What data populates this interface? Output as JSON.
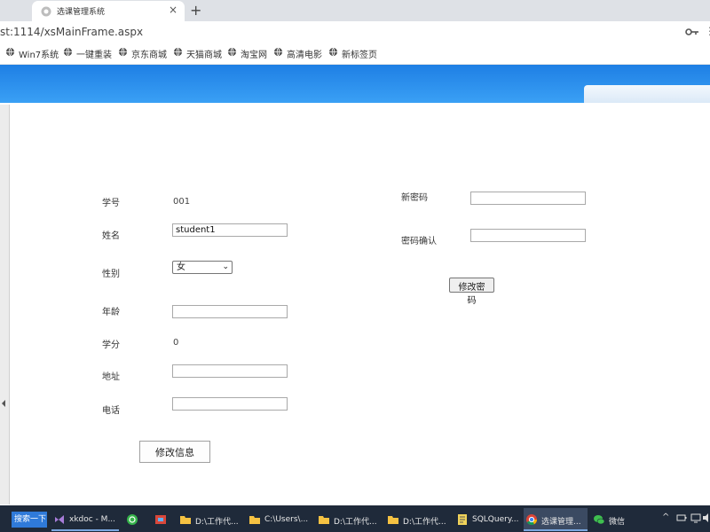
{
  "browser": {
    "tab_title": "选课管理系统",
    "tab_close": "×",
    "new_tab": "+",
    "url": "st:1114/xsMainFrame.aspx",
    "bookmarks": [
      "Win7系统",
      "一键重装",
      "京东商城",
      "天猫商城",
      "淘宝网",
      "高清电影",
      "新标签页"
    ]
  },
  "form": {
    "student_id_label": "学号",
    "student_id_value": "001",
    "name_label": "姓名",
    "name_value": "student1",
    "gender_label": "性别",
    "gender_value": "女",
    "age_label": "年龄",
    "age_value": "",
    "credits_label": "学分",
    "credits_value": "0",
    "address_label": "地址",
    "address_value": "",
    "phone_label": "电话",
    "phone_value": "",
    "submit_label": "修改信息"
  },
  "password": {
    "new_label": "新密码",
    "confirm_label": "密码确认",
    "submit_label": "修改密码"
  },
  "taskbar": {
    "search_label": "搜索一下",
    "items": [
      "xkdoc - M...",
      "",
      "",
      "D:\\工作代...",
      "C:\\Users\\...",
      "D:\\工作代...",
      "D:\\工作代...",
      "SQLQuery...",
      "选课管理...",
      "微信"
    ]
  },
  "colors": {
    "banner": "#2b8ef0",
    "taskbar": "#1f2a3a",
    "search": "#2f7ad9"
  }
}
